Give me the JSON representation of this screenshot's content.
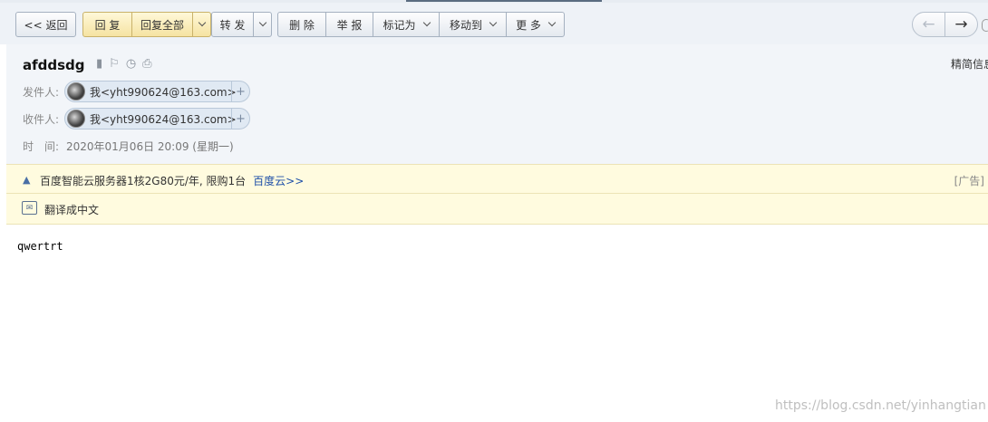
{
  "toolbar": {
    "back_label": "<< 返回",
    "reply_label": "回 复",
    "reply_all_label": "回复全部",
    "forward_label": "转 发",
    "delete_label": "删 除",
    "report_label": "举 报",
    "mark_as_label": "标记为",
    "move_to_label": "移动到",
    "more_label": "更 多",
    "prev_arrow": "←",
    "next_arrow": "→"
  },
  "mail": {
    "subject": "afddsdg",
    "plain_view_link": "精简信息",
    "from_label": "发件人:",
    "from_value": "我<yht990624@163.com>",
    "to_label": "收件人:",
    "to_value": "我<yht990624@163.com>",
    "time_label": "时　间:",
    "time_value": "2020年01月06日 20:09 (星期一)",
    "body": "qwertrt"
  },
  "ad": {
    "text": "百度智能云服务器1核2G80元/年, 限购1台",
    "link": "百度云>>",
    "tag": "[广告]"
  },
  "translate": {
    "label": "翻译成中文"
  },
  "watermark": "https://blog.csdn.net/yinhangtian",
  "colors": {
    "toolbar_bg": "#eef2f7",
    "header_bg": "#f2f5f9",
    "reply_button": "#f5e3a2",
    "banner_bg": "#fffbdf",
    "ad_link": "#1e4fa8"
  }
}
